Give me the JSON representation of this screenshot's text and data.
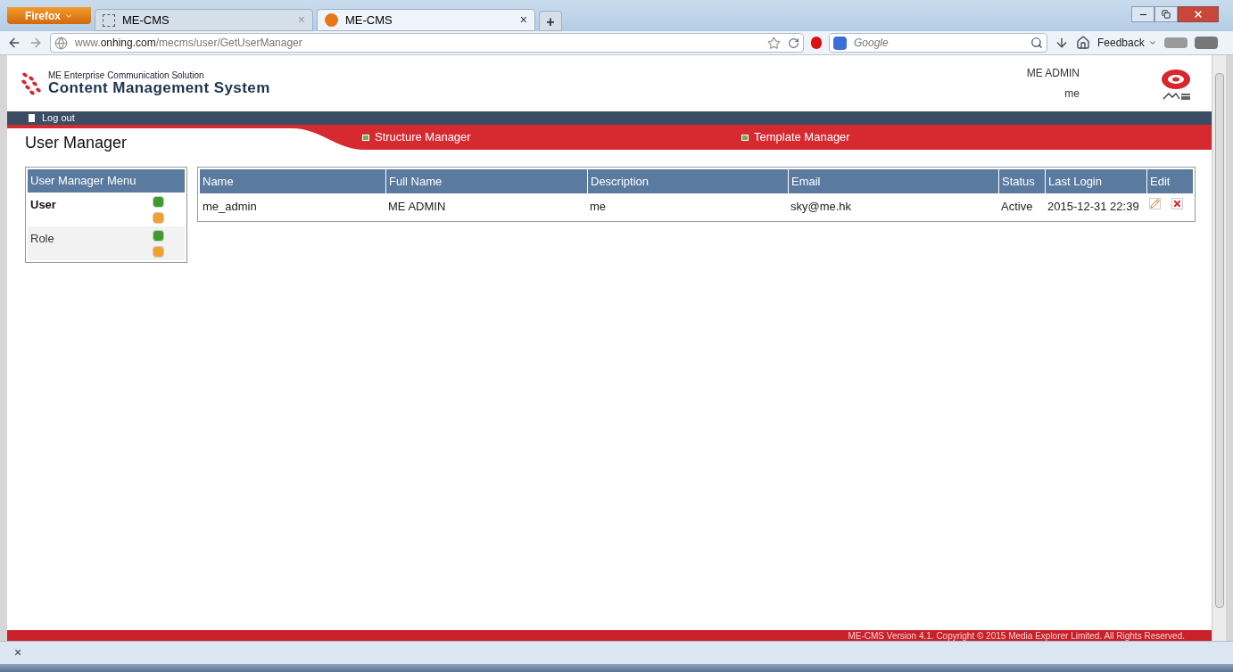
{
  "browser": {
    "menu_button": "Firefox",
    "tabs": [
      {
        "title": "ME-CMS",
        "close": "×",
        "selected": false
      },
      {
        "title": "ME-CMS",
        "close": "×",
        "selected": true
      }
    ],
    "new_tab": "+",
    "url_host": "www.",
    "url_domain": "onhing.com",
    "url_path": "/mecms/user/GetUserManager",
    "search_placeholder": "Google",
    "feedback": "Feedback"
  },
  "header": {
    "subtitle": "ME Enterprise Communication Solution",
    "title": "Content Management System",
    "user_name": "ME ADMIN",
    "user_desc": "me",
    "logout": "Log out"
  },
  "nav": [
    {
      "label": "Structure Manager"
    },
    {
      "label": "Template Manager"
    }
  ],
  "page_title": "User Manager",
  "menu": {
    "title": "User Manager Menu",
    "items": [
      {
        "label": "User",
        "selected": true
      },
      {
        "label": "Role",
        "selected": false
      }
    ]
  },
  "table": {
    "columns": [
      "Name",
      "Full Name",
      "Description",
      "Email",
      "Status",
      "Last Login",
      "Edit"
    ],
    "rows": [
      {
        "cells": [
          "me_admin",
          "ME ADMIN",
          "me",
          "sky@me.hk",
          "Active",
          "2015-12-31 22:39"
        ]
      }
    ]
  },
  "footer": "ME-CMS Version 4.1. Copyright © 2015 Media Explorer Limited. All Rights Reserved.",
  "find_bar": {
    "close": "×"
  }
}
